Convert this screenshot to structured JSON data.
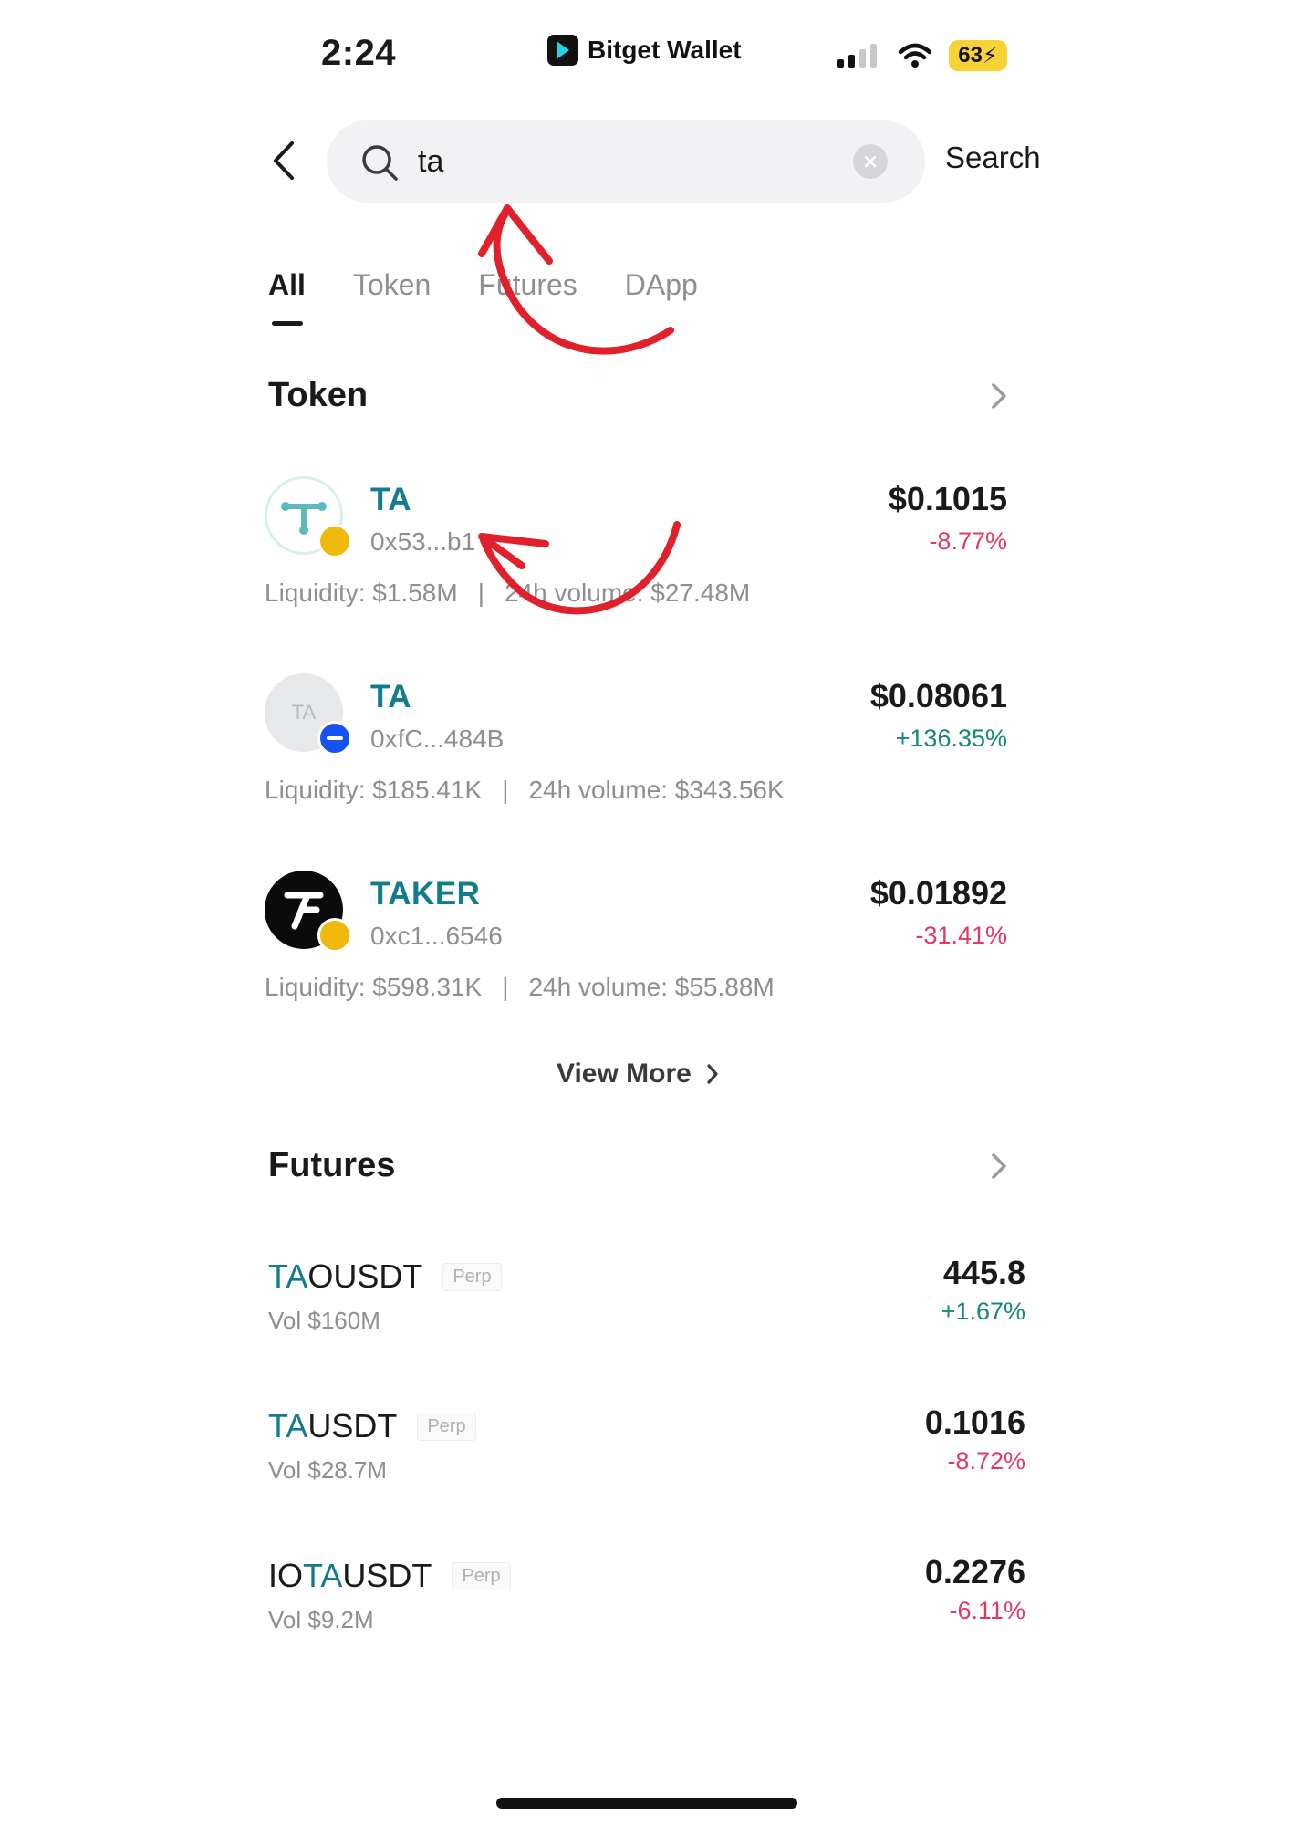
{
  "status_bar": {
    "time": "2:24",
    "app_name": "Bitget Wallet",
    "battery": "63"
  },
  "search": {
    "value": "ta",
    "action_label": "Search"
  },
  "tabs": [
    {
      "label": "All",
      "active": true
    },
    {
      "label": "Token",
      "active": false
    },
    {
      "label": "Futures",
      "active": false
    },
    {
      "label": "DApp",
      "active": false
    }
  ],
  "token_section": {
    "title": "Token",
    "items": [
      {
        "symbol": "TA",
        "address": "0x53...b1",
        "price": "$0.1015",
        "change": "-8.77%",
        "liquidity_label": "Liquidity: $1.58M",
        "volume_label": "24h volume: $27.48M"
      },
      {
        "symbol": "TA",
        "address": "0xfC...484B",
        "price": "$0.08061",
        "change": "+136.35%",
        "liquidity_label": "Liquidity: $185.41K",
        "volume_label": "24h volume: $343.56K",
        "avatar_text": "TA"
      },
      {
        "symbol": "TAKER",
        "address": "0xc1...6546",
        "price": "$0.01892",
        "change": "-31.41%",
        "liquidity_label": "Liquidity: $598.31K",
        "volume_label": "24h volume: $55.88M"
      }
    ],
    "separator": "|",
    "view_more_label": "View More"
  },
  "futures_section": {
    "title": "Futures",
    "items": [
      {
        "pre": "",
        "hl": "TA",
        "post": "OUSDT",
        "tag": "Perp",
        "vol": "Vol $160M",
        "price": "445.8",
        "change": "+1.67%"
      },
      {
        "pre": "",
        "hl": "TA",
        "post": "USDT",
        "tag": "Perp",
        "vol": "Vol $28.7M",
        "price": "0.1016",
        "change": "-8.72%"
      },
      {
        "pre": "IO",
        "hl": "TA",
        "post": "USDT",
        "tag": "Perp",
        "vol": "Vol $9.2M",
        "price": "0.2276",
        "change": "-6.11%"
      }
    ]
  },
  "colors": {
    "accent_teal": "#127c8c",
    "negative": "#e03a64",
    "positive": "#16877a",
    "annotation_red": "#e0202a"
  }
}
